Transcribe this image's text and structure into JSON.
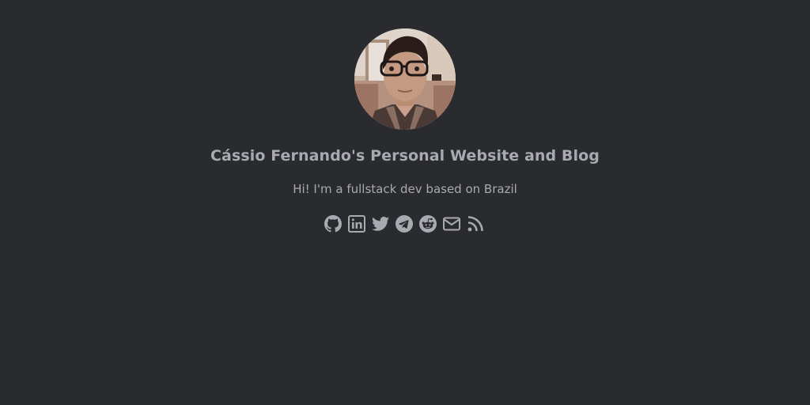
{
  "header": {
    "title": "Cássio Fernando's Personal Website and Blog",
    "bio": "Hi! I'm a fullstack dev based on Brazil"
  },
  "avatar": {
    "icon": "profile-photo"
  },
  "social_links": [
    {
      "icon": "github-icon"
    },
    {
      "icon": "linkedin-icon"
    },
    {
      "icon": "twitter-icon"
    },
    {
      "icon": "telegram-icon"
    },
    {
      "icon": "reddit-icon"
    },
    {
      "icon": "email-icon"
    },
    {
      "icon": "rss-icon"
    }
  ],
  "colors": {
    "background": "#2a2b2f",
    "text": "#a9aab1"
  }
}
